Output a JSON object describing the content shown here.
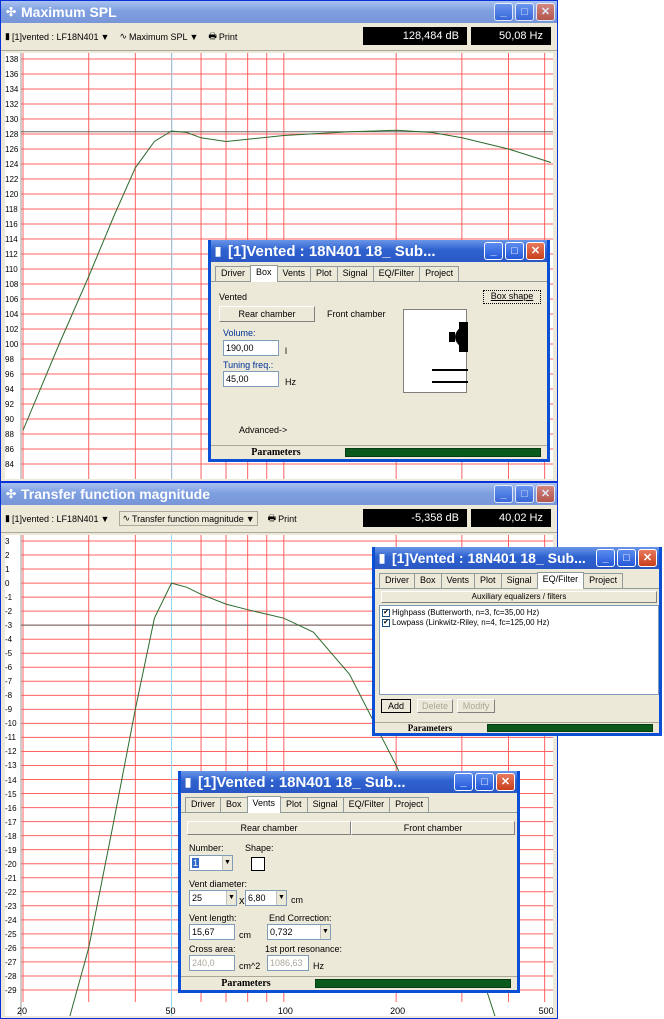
{
  "win1": {
    "title": "Maximum SPL",
    "tool_source": "[1]vented : LF18N401",
    "tool_graph": "Maximum SPL",
    "tool_print": "Print",
    "readout_value": "128,484 dB",
    "readout_freq": "50,08 Hz",
    "yticks": [
      "138",
      "136",
      "134",
      "132",
      "130",
      "128",
      "126",
      "124",
      "122",
      "120",
      "118",
      "116",
      "114",
      "112",
      "110",
      "108",
      "106",
      "104",
      "102",
      "100",
      "98",
      "96",
      "94",
      "92",
      "90",
      "88",
      "86",
      "84"
    ]
  },
  "win2": {
    "title": "Transfer function magnitude",
    "tool_source": "[1]vented : LF18N401",
    "tool_graph": "Transfer function magnitude",
    "tool_print": "Print",
    "readout_value": "-5,358 dB",
    "readout_freq": "40,02 Hz",
    "yticks": [
      "3",
      "2",
      "1",
      "0",
      "-1",
      "-2",
      "-3",
      "-4",
      "-5",
      "-6",
      "-7",
      "-8",
      "-9",
      "-10",
      "-11",
      "-12",
      "-13",
      "-14",
      "-15",
      "-16",
      "-17",
      "-18",
      "-19",
      "-20",
      "-21",
      "-22",
      "-23",
      "-24",
      "-25",
      "-26",
      "-27",
      "-28",
      "-29"
    ],
    "xticks": [
      "20",
      "50",
      "100",
      "200",
      "500"
    ]
  },
  "dlg_box": {
    "title": "[1]Vented : 18N401 18_ Sub...",
    "tabs": [
      "Driver",
      "Box",
      "Vents",
      "Plot",
      "Signal",
      "EQ/Filter",
      "Project"
    ],
    "active": "Box",
    "label_vented": "Vented",
    "box_shape": "Box shape",
    "rear": "Rear chamber",
    "front": "Front chamber",
    "volume_label": "Volume:",
    "volume": "190,00",
    "volume_unit": "l",
    "tuning_label": "Tuning freq.:",
    "tuning": "45,00",
    "tuning_unit": "Hz",
    "advanced": "Advanced->",
    "status": "Parameters"
  },
  "dlg_eq": {
    "title": "[1]Vented : 18N401 18_ Sub...",
    "tabs": [
      "Driver",
      "Box",
      "Vents",
      "Plot",
      "Signal",
      "EQ/Filter",
      "Project"
    ],
    "active": "EQ/Filter",
    "header": "Auxiliary equalizers / filters",
    "items": [
      "Highpass (Butterworth, n=3, fc=35,00 Hz)",
      "Lowpass (Linkwitz-Riley, n=4, fc=125,00 Hz)"
    ],
    "add": "Add",
    "delete": "Delete",
    "modify": "Modify",
    "status": "Parameters"
  },
  "dlg_vents": {
    "title": "[1]Vented : 18N401 18_ Sub...",
    "tabs": [
      "Driver",
      "Box",
      "Vents",
      "Plot",
      "Signal",
      "EQ/Filter",
      "Project"
    ],
    "active": "Vents",
    "rear": "Rear chamber",
    "front": "Front chamber",
    "number_label": "Number:",
    "number": "1",
    "shape_label": "Shape:",
    "diam_label": "Vent diameter:",
    "diam1": "25",
    "times": "x",
    "diam2": "6,80",
    "diam_unit": "cm",
    "length_label": "Vent length:",
    "length": "15,67",
    "length_unit": "cm",
    "endcorr_label": "End Correction:",
    "endcorr": "0,732",
    "cross_label": "Cross area:",
    "cross": "240,0",
    "cross_unit": "cm^2",
    "res_label": "1st port resonance:",
    "res": "1086,63",
    "res_unit": "Hz",
    "status": "Parameters"
  },
  "colors": {
    "grid": "#ff6060",
    "curve": "#2e6b2e",
    "cursor": "#8fd8f0"
  }
}
